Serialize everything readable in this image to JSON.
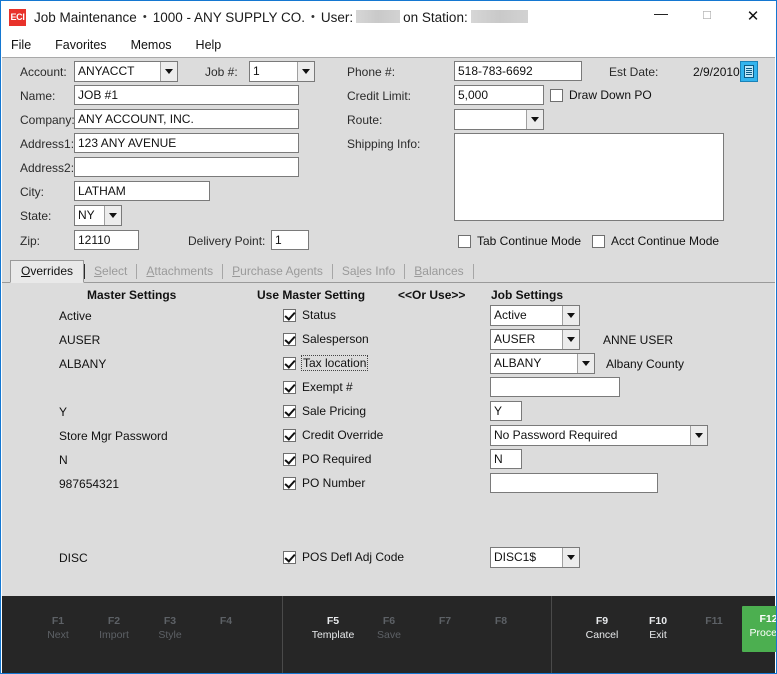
{
  "window": {
    "app_icon_text": "ECI",
    "title": "Job Maintenance",
    "sep1": "•",
    "company": "1000 - ANY SUPPLY CO.",
    "sep2": "•",
    "user_label": "User:",
    "station_label": "on Station:",
    "minimize": "—",
    "maximize": "☐",
    "close": "✕"
  },
  "menu": {
    "items": [
      "File",
      "Favorites",
      "Memos",
      "Help"
    ]
  },
  "form": {
    "account_label": "Account:",
    "account_value": "ANYACCT",
    "job_label": "Job #:",
    "job_value": "1",
    "name_label": "Name:",
    "name_value": "JOB #1",
    "company_label": "Company:",
    "company_value": "ANY ACCOUNT, INC.",
    "address1_label": "Address1:",
    "address1_value": "123 ANY AVENUE",
    "address2_label": "Address2:",
    "address2_value": "",
    "city_label": "City:",
    "city_value": "LATHAM",
    "state_label": "State:",
    "state_value": "NY",
    "zip_label": "Zip:",
    "zip_value": "12110",
    "delivery_point_label": "Delivery Point:",
    "delivery_point_value": "1",
    "phone_label": "Phone #:",
    "phone_value": "518-783-6692",
    "credit_limit_label": "Credit Limit:",
    "credit_limit_value": "5,000",
    "draw_down_po_label": "Draw Down PO",
    "route_label": "Route:",
    "route_value": "",
    "shipping_info_label": "Shipping Info:",
    "shipping_info_value": "",
    "est_date_label": "Est Date:",
    "est_date_value": "2/9/2010",
    "tab_continue_label": "Tab Continue Mode",
    "acct_continue_label": "Acct Continue Mode"
  },
  "tabs": [
    {
      "pre": "",
      "acc": "O",
      "post": "verrides",
      "active": true
    },
    {
      "pre": "",
      "acc": "S",
      "post": "elect",
      "active": false
    },
    {
      "pre": "",
      "acc": "A",
      "post": "ttachments",
      "active": false
    },
    {
      "pre": "",
      "acc": "P",
      "post": "urchase Agents",
      "active": false
    },
    {
      "pre": "Sa",
      "acc": "l",
      "post": "es Info",
      "active": false
    },
    {
      "pre": "",
      "acc": "B",
      "post": "alances",
      "active": false
    }
  ],
  "overrides": {
    "col_master": "Master Settings",
    "col_use_master": "Use Master Setting",
    "col_or_use": "<<Or Use>>",
    "col_job": "Job Settings",
    "rows": [
      {
        "master": "Active",
        "label": "Status",
        "checked": true,
        "focus": false,
        "job_kind": "combo",
        "job_value": "Active",
        "job_width": 90,
        "note": ""
      },
      {
        "master": "AUSER",
        "label": "Salesperson",
        "checked": true,
        "focus": false,
        "job_kind": "combo",
        "job_value": "AUSER",
        "job_width": 90,
        "note": "ANNE USER"
      },
      {
        "master": "ALBANY",
        "label": "Tax location",
        "checked": true,
        "focus": true,
        "job_kind": "combo",
        "job_value": "ALBANY",
        "job_width": 105,
        "note": "Albany County"
      },
      {
        "master": "",
        "label": "Exempt #",
        "checked": true,
        "focus": false,
        "job_kind": "text",
        "job_value": "",
        "job_width": 130,
        "note": ""
      },
      {
        "master": "Y",
        "label": "Sale Pricing",
        "checked": true,
        "focus": false,
        "job_kind": "text",
        "job_value": "Y",
        "job_width": 32,
        "note": ""
      },
      {
        "master": "Store Mgr Password",
        "label": "Credit Override",
        "checked": true,
        "focus": false,
        "job_kind": "combo",
        "job_value": "No Password Required",
        "job_width": 218,
        "note": ""
      },
      {
        "master": "N",
        "label": "PO Required",
        "checked": true,
        "focus": false,
        "job_kind": "text",
        "job_value": "N",
        "job_width": 32,
        "note": ""
      },
      {
        "master": "987654321",
        "label": "PO Number",
        "checked": true,
        "focus": false,
        "job_kind": "text",
        "job_value": "",
        "job_width": 168,
        "note": ""
      }
    ],
    "pos_row": {
      "master": "DISC",
      "label": "POS Defl Adj Code",
      "checked": true,
      "focus": false,
      "job_kind": "combo",
      "job_value": "DISC1$",
      "job_width": 90,
      "note": ""
    }
  },
  "fnbar": {
    "accent_color": "#4caf50",
    "groups": [
      {
        "keys": [
          {
            "fk": "F1",
            "fn": "Next",
            "enabled": false
          },
          {
            "fk": "F2",
            "fn": "Import",
            "enabled": false
          },
          {
            "fk": "F3",
            "fn": "Style",
            "enabled": false
          },
          {
            "fk": "F4",
            "fn": "",
            "enabled": false
          }
        ]
      },
      {
        "keys": [
          {
            "fk": "F5",
            "fn": "Template",
            "enabled": true
          },
          {
            "fk": "F6",
            "fn": "Save",
            "enabled": false
          },
          {
            "fk": "F7",
            "fn": "",
            "enabled": false
          },
          {
            "fk": "F8",
            "fn": "",
            "enabled": false
          }
        ]
      },
      {
        "keys": [
          {
            "fk": "F9",
            "fn": "Cancel",
            "enabled": true
          },
          {
            "fk": "F10",
            "fn": "Exit",
            "enabled": true
          },
          {
            "fk": "F11",
            "fn": "",
            "enabled": false
          },
          {
            "fk": "F12",
            "fn": "Process",
            "enabled": true,
            "primary": true
          }
        ]
      }
    ]
  }
}
